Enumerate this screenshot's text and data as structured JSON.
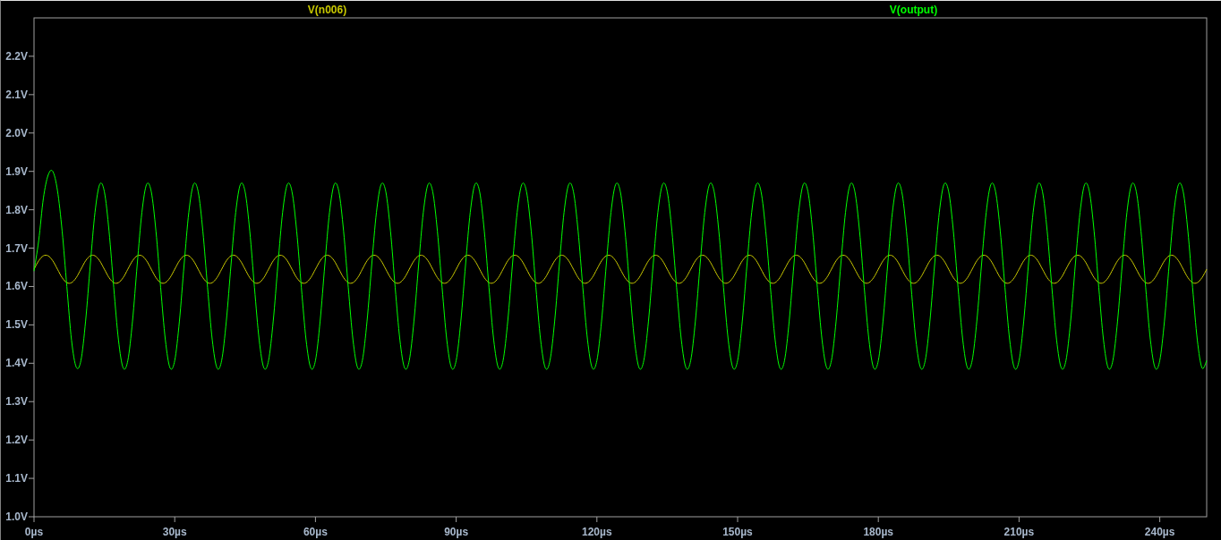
{
  "chart_data": {
    "type": "line",
    "xlim": [
      0,
      250
    ],
    "ylim": [
      1.0,
      2.3
    ],
    "xticks": [
      {
        "value": 0,
        "label": "0µs"
      },
      {
        "value": 30,
        "label": "30µs"
      },
      {
        "value": 60,
        "label": "60µs"
      },
      {
        "value": 90,
        "label": "90µs"
      },
      {
        "value": 120,
        "label": "120µs"
      },
      {
        "value": 150,
        "label": "150µs"
      },
      {
        "value": 180,
        "label": "180µs"
      },
      {
        "value": 210,
        "label": "210µs"
      },
      {
        "value": 240,
        "label": "240µs"
      }
    ],
    "yticks": [
      {
        "value": 1.0,
        "label": "1.0V"
      },
      {
        "value": 1.1,
        "label": "1.1V"
      },
      {
        "value": 1.2,
        "label": "1.2V"
      },
      {
        "value": 1.3,
        "label": "1.3V"
      },
      {
        "value": 1.4,
        "label": "1.4V"
      },
      {
        "value": 1.5,
        "label": "1.5V"
      },
      {
        "value": 1.6,
        "label": "1.6V"
      },
      {
        "value": 1.7,
        "label": "1.7V"
      },
      {
        "value": 1.8,
        "label": "1.8V"
      },
      {
        "value": 1.9,
        "label": "1.9V"
      },
      {
        "value": 2.0,
        "label": "2.0V"
      },
      {
        "value": 2.1,
        "label": "2.1V"
      },
      {
        "value": 2.2,
        "label": "2.2V"
      }
    ],
    "x": [
      0,
      1,
      2,
      3,
      4,
      5,
      6,
      7,
      8,
      9,
      10,
      11,
      12,
      13,
      14,
      15,
      16,
      17,
      18,
      19,
      20,
      21,
      22,
      23,
      24,
      25,
      26,
      27,
      28,
      29,
      30,
      31,
      32,
      33,
      34,
      35,
      36,
      37,
      38,
      39,
      40,
      41,
      42,
      43,
      44,
      45,
      46,
      47,
      48,
      49,
      50,
      51,
      52,
      53,
      54,
      55,
      56,
      57,
      58,
      59,
      60,
      61,
      62,
      63,
      64,
      65,
      66,
      67,
      68,
      69,
      70,
      71,
      72,
      73,
      74,
      75,
      76,
      77,
      78,
      79,
      80,
      81,
      82,
      83,
      84,
      85,
      86,
      87,
      88,
      89,
      90,
      91,
      92,
      93,
      94,
      95,
      96,
      97,
      98,
      99,
      100,
      101,
      102,
      103,
      104,
      105,
      106,
      107,
      108,
      109,
      110,
      111,
      112,
      113,
      114,
      115,
      116,
      117,
      118,
      119,
      120,
      121,
      122,
      123,
      124,
      125,
      126,
      127,
      128,
      129,
      130,
      131,
      132,
      133,
      134,
      135,
      136,
      137,
      138,
      139,
      140,
      141,
      142,
      143,
      144,
      145,
      146,
      147,
      148,
      149,
      150,
      151,
      152,
      153,
      154,
      155,
      156,
      157,
      158,
      159,
      160,
      161,
      162,
      163,
      164,
      165,
      166,
      167,
      168,
      169,
      170,
      171,
      172,
      173,
      174,
      175,
      176,
      177,
      178,
      179,
      180,
      181,
      182,
      183,
      184,
      185,
      186,
      187,
      188,
      189,
      190,
      191,
      192,
      193,
      194,
      195,
      196,
      197,
      198,
      199,
      200,
      201,
      202,
      203,
      204,
      205,
      206,
      207,
      208,
      209,
      210,
      211,
      212,
      213,
      214,
      215,
      216,
      217,
      218,
      219,
      220,
      221,
      222,
      223,
      224,
      225,
      226,
      227,
      228,
      229,
      230,
      231,
      232,
      233,
      234,
      235,
      236,
      237,
      238,
      239,
      240,
      241,
      242,
      243,
      244,
      245,
      246,
      247,
      248,
      249,
      250
    ],
    "series": [
      {
        "name": "V(n006)",
        "color": "#c8c800",
        "values": [
          1.645,
          1.667,
          1.68,
          1.68,
          1.667,
          1.645,
          1.623,
          1.61,
          1.61,
          1.623,
          1.645,
          1.667,
          1.68,
          1.68,
          1.667,
          1.645,
          1.623,
          1.61,
          1.61,
          1.623,
          1.645,
          1.667,
          1.68,
          1.68,
          1.667,
          1.645,
          1.623,
          1.61,
          1.61,
          1.623,
          1.645,
          1.667,
          1.68,
          1.68,
          1.667,
          1.645,
          1.623,
          1.61,
          1.61,
          1.623,
          1.645,
          1.667,
          1.68,
          1.68,
          1.667,
          1.645,
          1.623,
          1.61,
          1.61,
          1.623,
          1.645,
          1.667,
          1.68,
          1.68,
          1.667,
          1.645,
          1.623,
          1.61,
          1.61,
          1.623,
          1.645,
          1.667,
          1.68,
          1.68,
          1.667,
          1.645,
          1.623,
          1.61,
          1.61,
          1.623,
          1.645,
          1.667,
          1.68,
          1.68,
          1.667,
          1.645,
          1.623,
          1.61,
          1.61,
          1.623,
          1.645,
          1.667,
          1.68,
          1.68,
          1.667,
          1.645,
          1.623,
          1.61,
          1.61,
          1.623,
          1.645,
          1.667,
          1.68,
          1.68,
          1.667,
          1.645,
          1.623,
          1.61,
          1.61,
          1.623,
          1.645,
          1.667,
          1.68,
          1.68,
          1.667,
          1.645,
          1.623,
          1.61,
          1.61,
          1.623,
          1.645,
          1.667,
          1.68,
          1.68,
          1.667,
          1.645,
          1.623,
          1.61,
          1.61,
          1.623,
          1.645,
          1.667,
          1.68,
          1.68,
          1.667,
          1.645,
          1.623,
          1.61,
          1.61,
          1.623,
          1.645,
          1.667,
          1.68,
          1.68,
          1.667,
          1.645,
          1.623,
          1.61,
          1.61,
          1.623,
          1.645,
          1.667,
          1.68,
          1.68,
          1.667,
          1.645,
          1.623,
          1.61,
          1.61,
          1.623,
          1.645,
          1.667,
          1.68,
          1.68,
          1.667,
          1.645,
          1.623,
          1.61,
          1.61,
          1.623,
          1.645,
          1.667,
          1.68,
          1.68,
          1.667,
          1.645,
          1.623,
          1.61,
          1.61,
          1.623,
          1.645,
          1.667,
          1.68,
          1.68,
          1.667,
          1.645,
          1.623,
          1.61,
          1.61,
          1.623,
          1.645,
          1.667,
          1.68,
          1.68,
          1.667,
          1.645,
          1.623,
          1.61,
          1.61,
          1.623,
          1.645,
          1.667,
          1.68,
          1.68,
          1.667,
          1.645,
          1.623,
          1.61,
          1.61,
          1.623,
          1.645,
          1.667,
          1.68,
          1.68,
          1.667,
          1.645,
          1.623,
          1.61,
          1.61,
          1.623,
          1.645,
          1.667,
          1.68,
          1.68,
          1.667,
          1.645,
          1.623,
          1.61,
          1.61,
          1.623,
          1.645,
          1.667,
          1.68,
          1.68,
          1.667,
          1.645,
          1.623,
          1.61,
          1.61,
          1.623,
          1.645,
          1.667,
          1.68,
          1.68,
          1.667,
          1.645,
          1.623,
          1.61,
          1.61,
          1.623,
          1.645,
          1.667,
          1.68,
          1.68,
          1.667,
          1.645,
          1.623,
          1.61,
          1.61,
          1.623,
          1.645
        ]
      },
      {
        "name": "V(output)",
        "color": "#00ff00",
        "values": [
          1.64,
          1.72,
          1.83,
          1.89,
          1.9,
          1.85,
          1.744,
          1.6,
          1.46,
          1.39,
          1.407,
          1.51,
          1.657,
          1.793,
          1.866,
          1.847,
          1.744,
          1.597,
          1.461,
          1.388,
          1.407,
          1.51,
          1.657,
          1.793,
          1.866,
          1.847,
          1.744,
          1.597,
          1.461,
          1.388,
          1.407,
          1.51,
          1.657,
          1.793,
          1.866,
          1.847,
          1.744,
          1.597,
          1.461,
          1.388,
          1.407,
          1.51,
          1.657,
          1.793,
          1.866,
          1.847,
          1.744,
          1.597,
          1.461,
          1.388,
          1.407,
          1.51,
          1.657,
          1.793,
          1.866,
          1.847,
          1.744,
          1.597,
          1.461,
          1.388,
          1.407,
          1.51,
          1.657,
          1.793,
          1.866,
          1.847,
          1.744,
          1.597,
          1.461,
          1.388,
          1.407,
          1.51,
          1.657,
          1.793,
          1.866,
          1.847,
          1.744,
          1.597,
          1.461,
          1.388,
          1.407,
          1.51,
          1.657,
          1.793,
          1.866,
          1.847,
          1.744,
          1.597,
          1.461,
          1.388,
          1.407,
          1.51,
          1.657,
          1.793,
          1.866,
          1.847,
          1.744,
          1.597,
          1.461,
          1.388,
          1.407,
          1.51,
          1.657,
          1.793,
          1.866,
          1.847,
          1.744,
          1.597,
          1.461,
          1.388,
          1.407,
          1.51,
          1.657,
          1.793,
          1.866,
          1.847,
          1.744,
          1.597,
          1.461,
          1.388,
          1.407,
          1.51,
          1.657,
          1.793,
          1.866,
          1.847,
          1.744,
          1.597,
          1.461,
          1.388,
          1.407,
          1.51,
          1.657,
          1.793,
          1.866,
          1.847,
          1.744,
          1.597,
          1.461,
          1.388,
          1.407,
          1.51,
          1.657,
          1.793,
          1.866,
          1.847,
          1.744,
          1.597,
          1.461,
          1.388,
          1.407,
          1.51,
          1.657,
          1.793,
          1.866,
          1.847,
          1.744,
          1.597,
          1.461,
          1.388,
          1.407,
          1.51,
          1.657,
          1.793,
          1.866,
          1.847,
          1.744,
          1.597,
          1.461,
          1.388,
          1.407,
          1.51,
          1.657,
          1.793,
          1.866,
          1.847,
          1.744,
          1.597,
          1.461,
          1.388,
          1.407,
          1.51,
          1.657,
          1.793,
          1.866,
          1.847,
          1.744,
          1.597,
          1.461,
          1.388,
          1.407,
          1.51,
          1.657,
          1.793,
          1.866,
          1.847,
          1.744,
          1.597,
          1.461,
          1.388,
          1.407,
          1.51,
          1.657,
          1.793,
          1.866,
          1.847,
          1.744,
          1.597,
          1.461,
          1.388,
          1.407,
          1.51,
          1.657,
          1.793,
          1.866,
          1.847,
          1.744,
          1.597,
          1.461,
          1.388,
          1.407,
          1.51,
          1.657,
          1.793,
          1.866,
          1.847,
          1.744,
          1.597,
          1.461,
          1.388,
          1.407,
          1.51,
          1.657,
          1.793,
          1.866,
          1.847,
          1.744,
          1.597,
          1.461,
          1.388,
          1.407,
          1.51,
          1.657,
          1.793,
          1.866,
          1.847,
          1.744,
          1.597,
          1.461,
          1.388,
          1.407
        ]
      }
    ]
  }
}
